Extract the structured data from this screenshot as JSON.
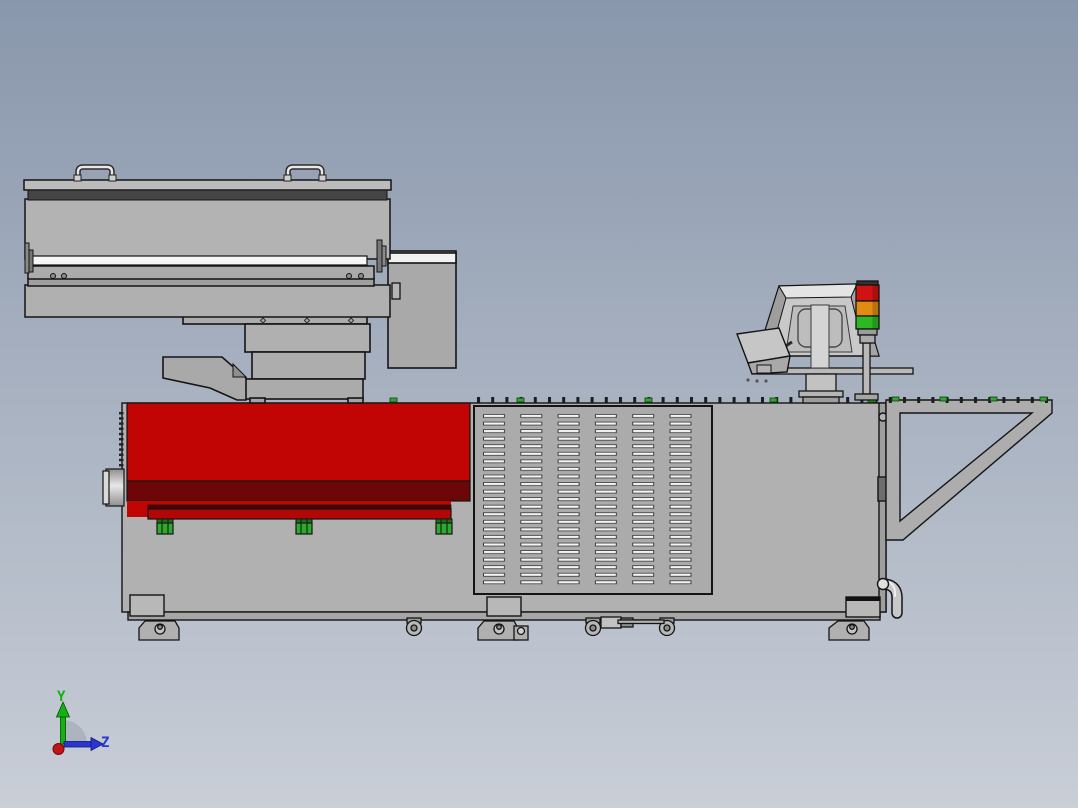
{
  "viewport": {
    "kind": "cad-3d-side-view",
    "axis_triad": {
      "y_label": "Y",
      "z_label": "Z"
    },
    "colors": {
      "bg_top": "#8997ac",
      "bg_bottom": "#c9ced7",
      "machine_gray": "#b1b1b1",
      "machine_gray_soft": "#a9a9a9",
      "outline": "#141414",
      "red_main": "#c10505",
      "red_dark": "#6d0606",
      "red_rail": "#b30707",
      "rail_shadow": "#4c0303",
      "green_mount": "#2fa82f",
      "green_mount_dark": "#1f6b1f",
      "tower_red": "#d01212",
      "tower_amber": "#e08c12",
      "tower_green": "#2db822",
      "axis_y": "#12b212",
      "axis_z": "#2a35d6",
      "axis_x": "#c21616",
      "stripe_dark": "#454545",
      "roller_white": "#f6f6f6",
      "cabinet_top_white": "#f2f2f2",
      "vent_slot": "#f4f4f4",
      "chrome_light": "#e8e8e8"
    }
  }
}
